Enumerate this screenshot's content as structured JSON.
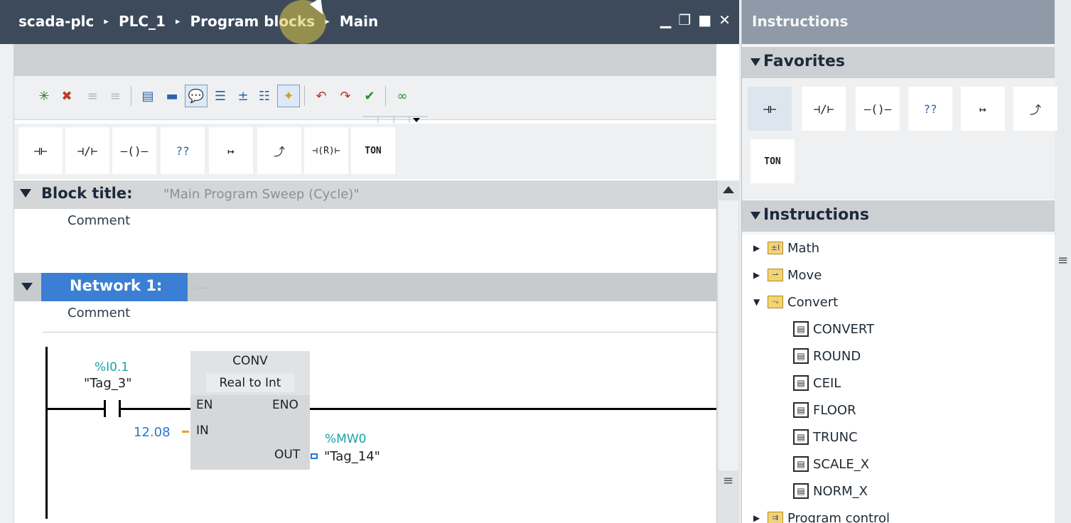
{
  "editor": {
    "breadcrumb": [
      "scada-plc",
      "PLC_1",
      "Program blocks",
      "Main"
    ],
    "breadcrumb_sep": "▸",
    "window_buttons": [
      "▁",
      "❐",
      "■",
      "✕"
    ],
    "toolbar_icons": [
      "insert-network-icon",
      "delete-network-icon",
      "insert-row-icon",
      "delete-row-icon",
      "absolute-operands-icon",
      "network-overview-icon",
      "comment-icon",
      "favorites-icon",
      "expand-collapse-icon",
      "show-list-icon",
      "insert-favorites-icon",
      "go-to-previous-error-icon",
      "go-to-next-error-icon",
      "download-icon",
      "monitoring-icon"
    ],
    "instruction_bar": [
      "⊣⊢",
      "⊣/⊢",
      "—()—",
      "??",
      "↦",
      "⤴",
      "⊣(R)⊢",
      "TON"
    ],
    "block_title_label": "Block title:",
    "block_title_value": "\"Main Program Sweep (Cycle)\"",
    "block_comment": "Comment",
    "network_label": "Network 1:",
    "network_dots": ".....",
    "network_comment": "Comment",
    "ladder": {
      "contact_address": "%I0.1",
      "contact_tag": "\"Tag_3\"",
      "block_name": "CONV",
      "block_subtype": "Real to Int",
      "pin_en": "EN",
      "pin_eno": "ENO",
      "pin_in": "IN",
      "pin_out": "OUT",
      "in_value": "12.08",
      "out_address": "%MW0",
      "out_tag": "\"Tag_14\""
    }
  },
  "right_pane": {
    "title": "Instructions",
    "favorites_label": "Favorites",
    "favorites": [
      "⊣⊢",
      "⊣/⊢",
      "—()—",
      "??",
      "↦",
      "⤴",
      "TON"
    ],
    "instructions_label": "Instructions",
    "tree": [
      {
        "label": "Math",
        "icon": "±I",
        "expanded": false
      },
      {
        "label": "Move",
        "icon": "⇀",
        "expanded": false
      },
      {
        "label": "Convert",
        "icon": "⤳",
        "expanded": true
      },
      {
        "label": "CONVERT",
        "child": true
      },
      {
        "label": "ROUND",
        "child": true
      },
      {
        "label": "CEIL",
        "child": true
      },
      {
        "label": "FLOOR",
        "child": true
      },
      {
        "label": "TRUNC",
        "child": true
      },
      {
        "label": "SCALE_X",
        "child": true
      },
      {
        "label": "NORM_X",
        "child": true
      },
      {
        "label": "Program control",
        "icon": "⇉",
        "expanded": false
      }
    ]
  },
  "colors": {
    "titlebar": "#3c4a5c",
    "selection": "#3b7fd4",
    "address": "#1aa3a3",
    "value": "#2878c8"
  }
}
